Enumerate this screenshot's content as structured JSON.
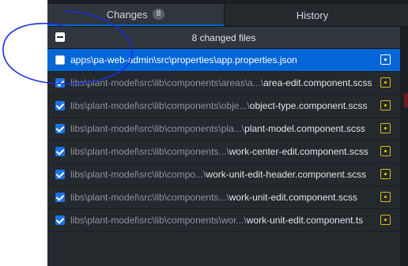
{
  "tabs": {
    "changes_label": "Changes",
    "changes_count": "8",
    "history_label": "History"
  },
  "changes_header": {
    "title": "8 changed files",
    "select_all_state": "indeterminate"
  },
  "files": [
    {
      "dir": "apps\\pa-web-admin\\src\\properties\\",
      "name": "app.properties.json",
      "checked": false,
      "selected": true,
      "status": "modified"
    },
    {
      "dir": "libs\\plant-model\\src\\lib\\components\\areas\\a...\\",
      "name": "area-edit.component.scss",
      "checked": true,
      "selected": false,
      "status": "modified"
    },
    {
      "dir": "libs\\plant-model\\src\\lib\\components\\obje...\\",
      "name": "object-type.component.scss",
      "checked": true,
      "selected": false,
      "status": "modified"
    },
    {
      "dir": "libs\\plant-model\\src\\lib\\components\\pla...\\",
      "name": "plant-model.component.scss",
      "checked": true,
      "selected": false,
      "status": "modified"
    },
    {
      "dir": "libs\\plant-model\\src\\lib\\components...\\",
      "name": "work-center-edit.component.scss",
      "checked": true,
      "selected": false,
      "status": "modified"
    },
    {
      "dir": "libs\\plant-model\\src\\lib\\compo...\\",
      "name": "work-unit-edit-header.component.scss",
      "checked": true,
      "selected": false,
      "status": "modified"
    },
    {
      "dir": "libs\\plant-model\\src\\lib\\components...\\",
      "name": "work-unit-edit.component.scss",
      "checked": true,
      "selected": false,
      "status": "modified"
    },
    {
      "dir": "libs\\plant-model\\src\\lib\\components\\wor...\\",
      "name": "work-unit-edit.component.ts",
      "checked": true,
      "selected": false,
      "status": "modified"
    }
  ],
  "colors": {
    "accent": "#0366d6",
    "checkbox": "#1a73e8",
    "modified_status": "#d7ba0b",
    "background": "#24292e",
    "annotation": "#1a2fd6"
  }
}
